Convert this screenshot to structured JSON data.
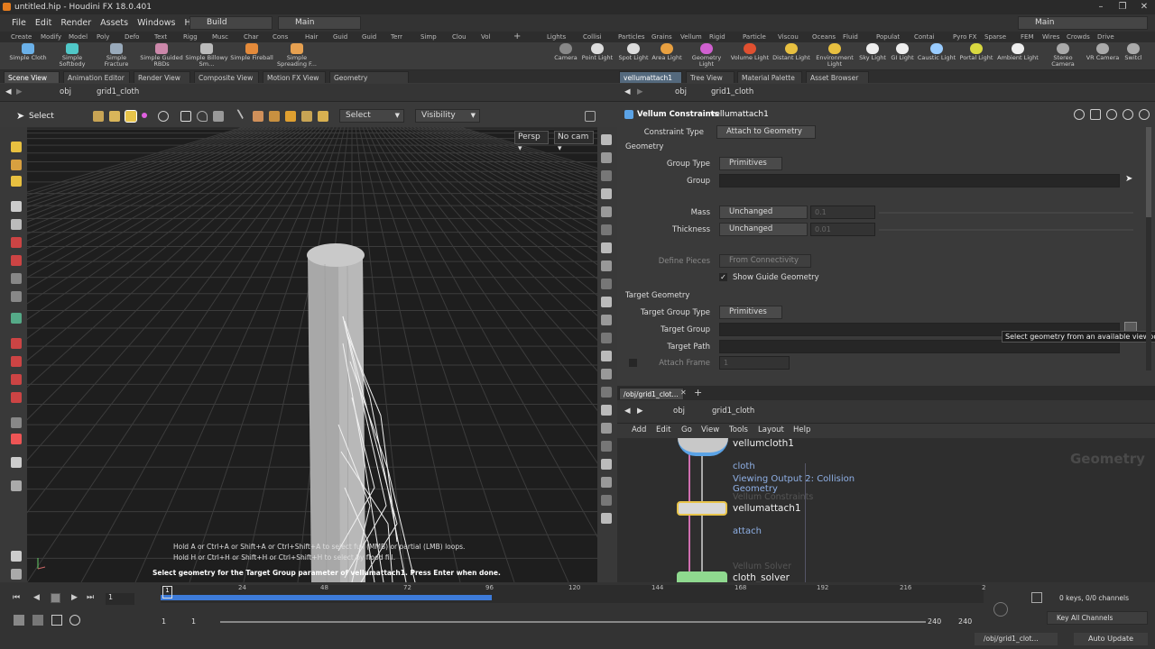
{
  "window": {
    "title": "untitled.hip - Houdini FX 18.0.401"
  },
  "menu": {
    "items": [
      "File",
      "Edit",
      "Render",
      "Assets",
      "Windows",
      "Help"
    ],
    "desktop": "Build",
    "desktop_right": "Main",
    "shelf_set": "Main"
  },
  "shelf_tabs_left": [
    "Create",
    "Modify",
    "Model",
    "Poly",
    "Defo",
    "Text",
    "Rigg",
    "Musc",
    "Char",
    "Cons",
    "Hair",
    "Guid",
    "Guid",
    "Terr",
    "Simp",
    "Clou",
    "Vol"
  ],
  "shelf_tabs_right": [
    "Lights",
    "Collisi",
    "Particles",
    "Grains",
    "Vellum",
    "Rigid",
    "Particle",
    "Viscou",
    "Oceans",
    "Fluid",
    "Populat",
    "Contai",
    "Pyro FX",
    "Sparse",
    "FEM",
    "Wires",
    "Crowds",
    "Drive"
  ],
  "shelf_tools_left": [
    "Simple Cloth",
    "Simple Softbody",
    "Simple Fracture",
    "Simple Guided RBDs",
    "Simple Billowy Sm...",
    "Simple Fireball",
    "Simple Spreading F..."
  ],
  "shelf_tools_right": [
    "Camera",
    "Point Light",
    "Spot Light",
    "Area Light",
    "Geometry Light",
    "Volume Light",
    "Distant Light",
    "Environment Light",
    "Sky Light",
    "GI Light",
    "Caustic Light",
    "Portal Light",
    "Ambient Light",
    "Stereo Camera",
    "VR Camera",
    "Switcl"
  ],
  "left_tabs": [
    "Scene View",
    "Animation Editor",
    "Render View",
    "Composite View",
    "Motion FX View",
    "Geometry Spreadsheet"
  ],
  "right_tabs": [
    "vellumattach1",
    "Tree View",
    "Material Palette",
    "Asset Browser"
  ],
  "left_path": {
    "context": "obj",
    "node": "grid1_cloth"
  },
  "right_path": {
    "context": "obj",
    "node": "grid1_cloth"
  },
  "viewport": {
    "tool": "Select",
    "select_mode": "Select",
    "visibility": "Visibility",
    "persp": "Persp ▾",
    "cam": "No cam ▾",
    "hint1": "Hold A or Ctrl+A or Shift+A or Ctrl+Shift+A to select full (MMB) or partial (LMB) loops.",
    "hint2": "Hold H or Ctrl+H or Shift+H or Ctrl+Shift+H to select by flood fill.",
    "status": "Select geometry for the Target Group parameter of vellumattach1. Press Enter when done."
  },
  "params": {
    "node_type": "Vellum Constraints",
    "node_name": "vellumattach1",
    "constraint_type_label": "Constraint Type",
    "constraint_type": "Attach to Geometry",
    "geometry_section": "Geometry",
    "group_type_label": "Group Type",
    "group_type": "Primitives",
    "group_label": "Group",
    "mass_label": "Mass",
    "mass_mode": "Unchanged",
    "mass_value": "0.1",
    "thickness_label": "Thickness",
    "thickness_mode": "Unchanged",
    "thickness_value": "0.01",
    "define_pieces_label": "Define Pieces",
    "define_pieces": "From Connectivity",
    "show_guide": "Show Guide Geometry",
    "target_section": "Target Geometry",
    "target_group_type_label": "Target Group Type",
    "target_group_type": "Primitives",
    "target_group_label": "Target Group",
    "target_path_label": "Target Path",
    "attach_frame_label": "Attach Frame",
    "attach_frame": "1",
    "tooltip": "Select geometry from an available viewport."
  },
  "network": {
    "tab": "/obj/grid1_clot...",
    "menu": [
      "Add",
      "Edit",
      "Go",
      "View",
      "Tools",
      "Layout",
      "Help"
    ],
    "watermark": "Geometry",
    "nodes": [
      {
        "name": "vellumcloth1",
        "sub": "cloth"
      },
      {
        "name": "vellumattach1",
        "sub": "attach"
      },
      {
        "name": "cloth_solver",
        "sub": ""
      }
    ],
    "viewing": "Viewing Output 2: Collision Geometry",
    "ghost1": "Vellum Constraints",
    "ghost2": "Vellum Solver"
  },
  "timeline": {
    "frame": "1",
    "ticks": [
      "1",
      "24",
      "48",
      "72",
      "96",
      "120",
      "144",
      "168",
      "192",
      "216",
      "2"
    ],
    "start": "1",
    "start2": "1",
    "end": "240",
    "end2": "240",
    "keys": "0 keys, 0/0 channels",
    "key_all": "Key All Channels",
    "path": "/obj/grid1_clot...",
    "update": "Auto Update"
  },
  "colors": {
    "accent": "#4a8fe7",
    "selected_node": "#e8c44a",
    "cloth_node": "#5ba3e6",
    "solver_node": "#8fd98f"
  }
}
